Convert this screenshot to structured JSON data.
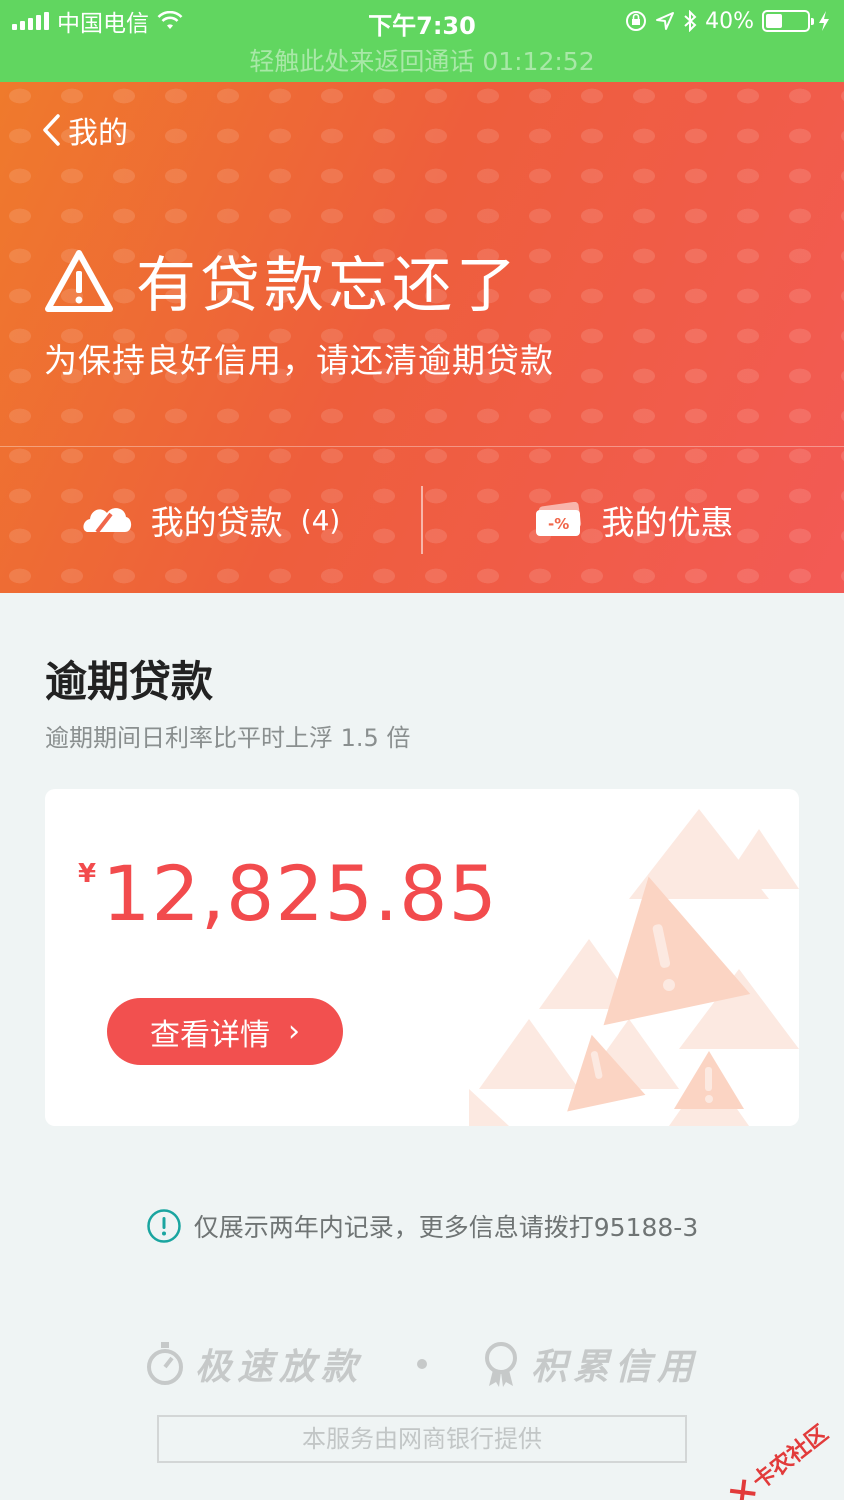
{
  "status_bar": {
    "carrier": "中国电信",
    "time": "下午7:30",
    "battery": "40%",
    "battery_level": 0.4,
    "return_call": "轻触此处来返回通话 01:12:52"
  },
  "header": {
    "back_label": "我的",
    "alert_title": "有贷款忘还了",
    "alert_subtitle": "为保持良好信用，请还清逾期贷款",
    "tabs": [
      {
        "label": "我的贷款",
        "count": "(4)",
        "icon": "cloud-loan-icon"
      },
      {
        "label": "我的优惠",
        "icon": "coupon-icon"
      }
    ]
  },
  "section": {
    "title": "逾期贷款",
    "subtitle": "逾期期间日利率比平时上浮 1.5 倍"
  },
  "card": {
    "currency": "¥",
    "amount": "12,825.85",
    "button_label": "查看详情",
    "button_arrow": "›"
  },
  "notice": "仅展示两年内记录，更多信息请拨打95188-3",
  "brand": {
    "items": [
      "极速放款",
      "积累信用"
    ],
    "provider": "本服务由网商银行提供"
  },
  "watermark": "卡农社区",
  "colors": {
    "status_green": "#61d660",
    "header_orange": "#ef7a2c",
    "header_red": "#f35a55",
    "amount_red": "#f24b4d",
    "background": "#eff4f4"
  }
}
